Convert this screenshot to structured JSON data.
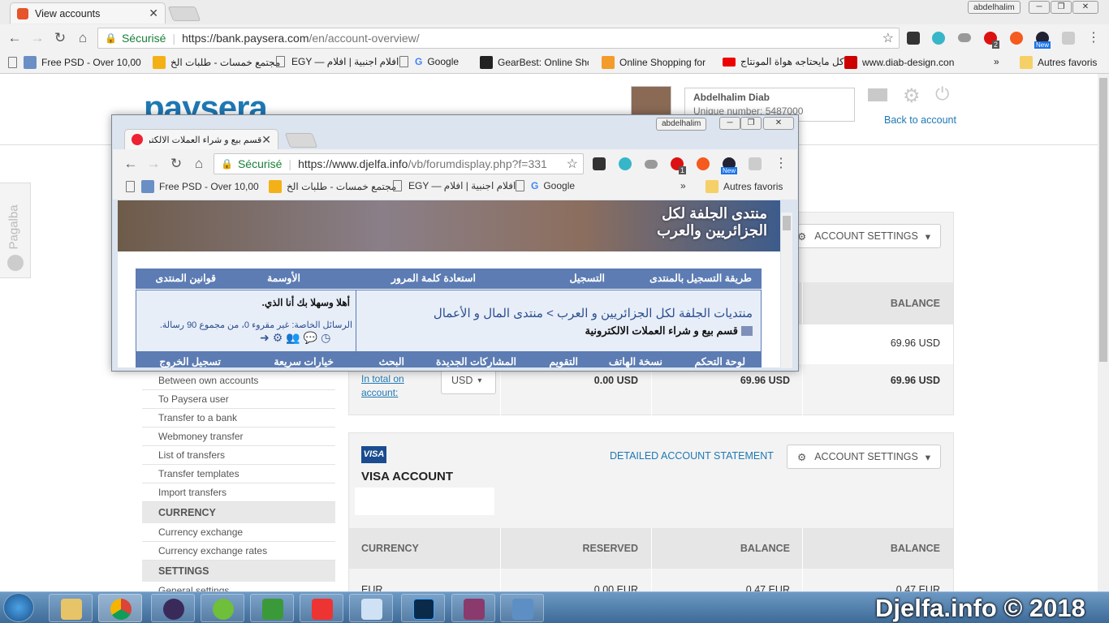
{
  "outer_browser": {
    "tab_title": "View accounts",
    "profile_name": "abdelhalim",
    "security_label": "Sécurisé",
    "url_host": "https://bank.paysera.com",
    "url_path": "/en/account-overview/",
    "bookmarks": [
      "Free PSD - Over 10,00",
      "مجتمع خمسات - طلبات الخ",
      "EGY — افلام اجنبية | افلام",
      "Google",
      "GearBest: Online Sho",
      "Online Shopping for",
      "كل مايحتاجه هواة المونتاج",
      "www.diab-design.con",
      "Autres favoris"
    ],
    "chevron": "»",
    "badge_count": "2",
    "new_badge": "New"
  },
  "paysera": {
    "logo": "paysera",
    "user_name": "Abdelhalim Diab",
    "unique_number": "Unique number: 5487000",
    "back_link": "Back to account",
    "account_settings": "ACCOUNT SETTINGS",
    "balance_header": "BALANCE",
    "balance_value_1": "69.96 USD",
    "in_total_label": "In total on account:",
    "currency_select": "USD",
    "total_reserved": "0.00 USD",
    "total_balance_1": "69.96 USD",
    "total_balance_2": "69.96 USD",
    "sidebar": {
      "links_transfers": [
        "Between own accounts",
        "To Paysera user",
        "Transfer to a bank",
        "Webmoney transfer",
        "List of transfers",
        "Transfer templates",
        "Import transfers"
      ],
      "currency_head": "CURRENCY",
      "links_currency": [
        "Currency exchange",
        "Currency exchange rates"
      ],
      "settings_head": "SETTINGS",
      "settings_first": "General settings"
    },
    "visa": {
      "badge": "VISA",
      "title": "VISA ACCOUNT",
      "statement_link": "DETAILED ACCOUNT STATEMENT",
      "settings_btn": "ACCOUNT SETTINGS",
      "headers": [
        "CURRENCY",
        "RESERVED",
        "BALANCE",
        "BALANCE"
      ],
      "row": [
        "EUR",
        "0.00 EUR",
        "0.47 EUR",
        "0.47 EUR"
      ]
    }
  },
  "sidetab": {
    "label": "Pagalba"
  },
  "popup_browser": {
    "tab_title": "قسم بيع و شراء العملات الالكترو",
    "profile_name": "abdelhalim",
    "security_label": "Sécurisé",
    "url_host": "https://www.djelfa.info",
    "url_path": "/vb/forumdisplay.php?f=331",
    "bookmarks": [
      "Free PSD - Over 10,00",
      "مجتمع خمسات - طلبات الخ",
      "EGY — افلام اجنبية | افلام",
      "Google",
      "Autres favoris"
    ],
    "chevron": "»",
    "badge_count": "1",
    "new_badge": "New",
    "forum": {
      "banner_text": "منتدى الجلفة لكل الجزائريين والعرب",
      "topnav": [
        "طريقة التسجيل بالمنتدى",
        "التسجيل",
        "استعادة كلمة المرور",
        "الأوسمة",
        "قوانين المنتدى"
      ],
      "breadcrumb": "منتديات الجلفة لكل الجزائريين و العرب > منتدى المال و الأعمال",
      "current_forum": "قسم بيع و شراء العملات الالكترونية",
      "welcome": "أهلا وسهلا بك أنا الذي.",
      "pm_status": "الرسائل الخاصة: غير مقروء 0، من مجموع 90 رسالة.",
      "bottomnav": [
        "لوحة التحكم",
        "نسخة الهاتف",
        "التقويم",
        "المشاركات الجديدة",
        "البحث",
        "خيارات سريعة",
        "تسجيل الخروج"
      ]
    }
  },
  "taskbar": {
    "watermark": "Djelfa.info © 2018"
  }
}
